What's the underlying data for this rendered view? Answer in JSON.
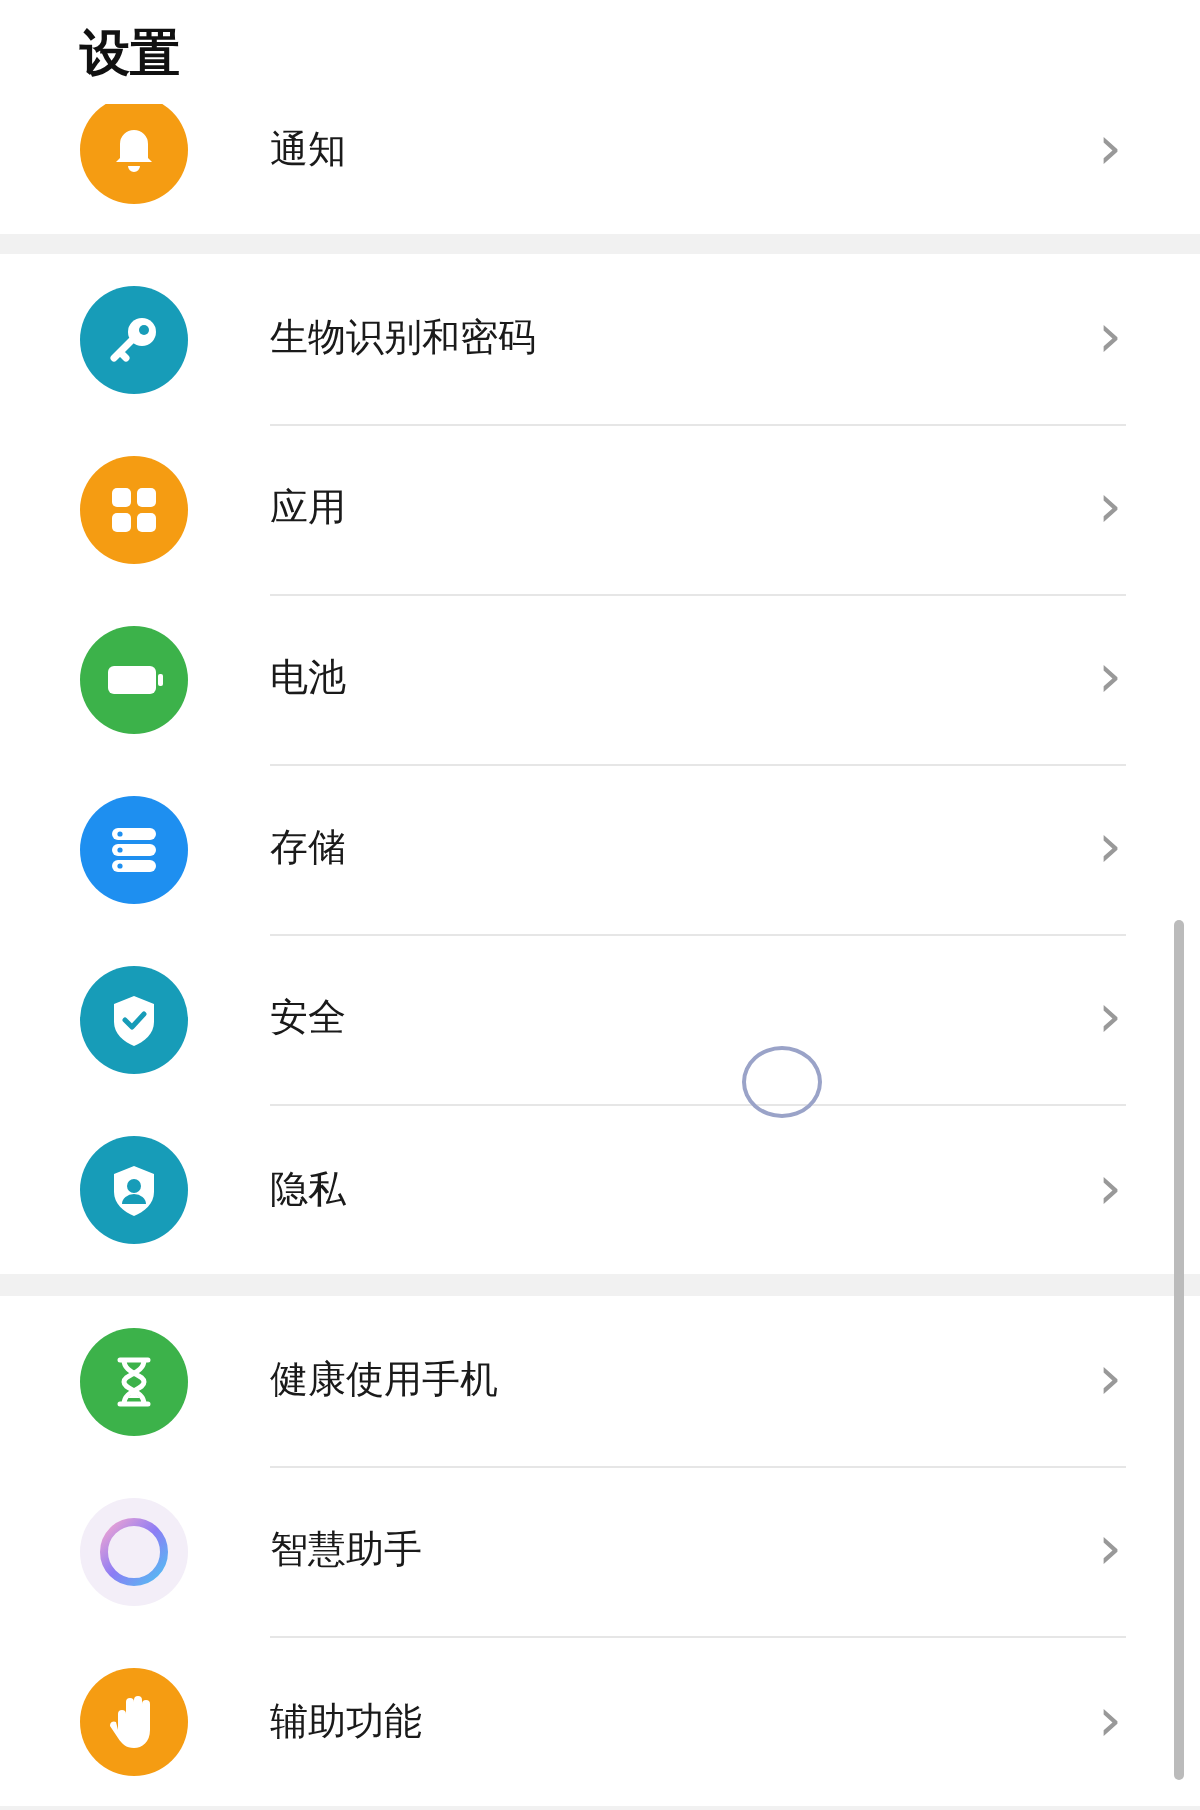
{
  "title": "设置",
  "sections": [
    {
      "items": [
        {
          "label": "通知",
          "color": "#f59c12",
          "chevron": "›"
        }
      ]
    },
    {
      "items": [
        {
          "label": "生物识别和密码",
          "color": "#179cb8",
          "chevron": "›"
        },
        {
          "label": "应用",
          "color": "#f59c12",
          "chevron": "›"
        },
        {
          "label": "电池",
          "color": "#3cb24a",
          "chevron": "›"
        },
        {
          "label": "存储",
          "color": "#1e8ff0",
          "chevron": "›"
        },
        {
          "label": "安全",
          "color": "#179cb8",
          "chevron": "›"
        },
        {
          "label": "隐私",
          "color": "#179cb8",
          "chevron": "›"
        }
      ]
    },
    {
      "items": [
        {
          "label": "健康使用手机",
          "color": "#3cb24a",
          "chevron": "›"
        },
        {
          "label": "智慧助手",
          "chevron": "›"
        },
        {
          "label": "辅助功能",
          "color": "#f59c12",
          "chevron": "›"
        }
      ]
    }
  ]
}
